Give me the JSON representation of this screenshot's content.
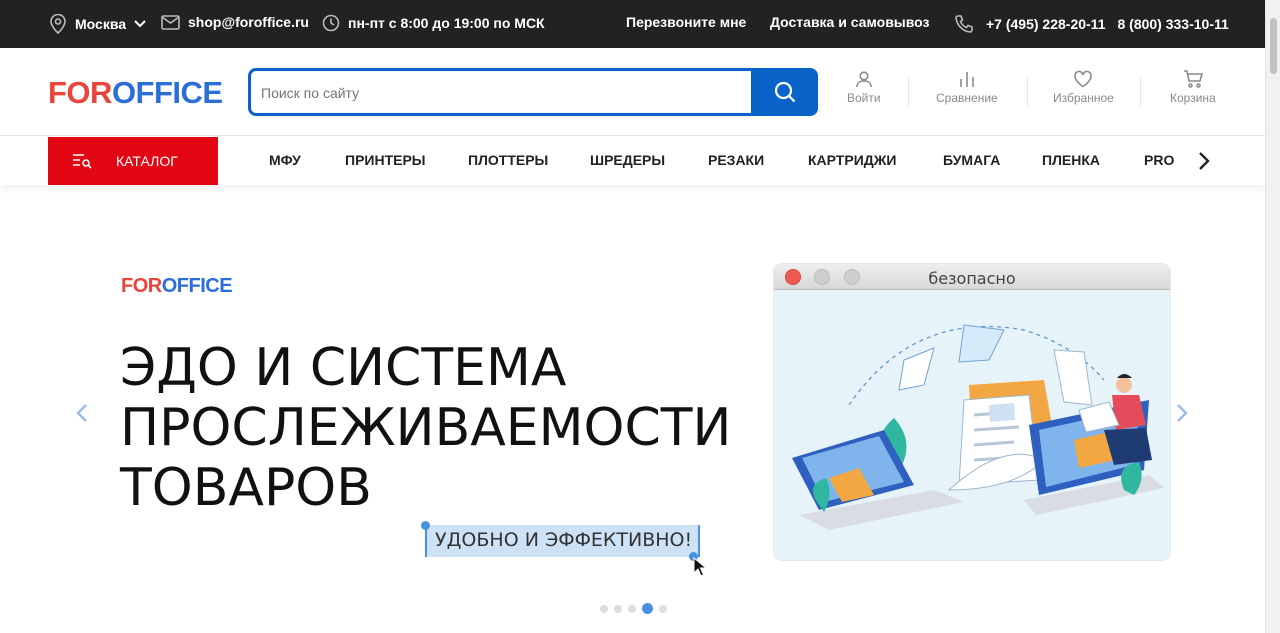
{
  "topbar": {
    "city": "Москва",
    "email": "shop@foroffice.ru",
    "hours": "пн-пт с 8:00 до 19:00 по МСК",
    "callback": "Перезвоните мне",
    "delivery": "Доставка и самовывоз",
    "phone1": "+7 (495) 228-20-11",
    "phone2": "8 (800) 333-10-11"
  },
  "header": {
    "logo_red": "FOR",
    "logo_blue": "OFFICE",
    "search_placeholder": "Поиск по сайту",
    "login": "Войти",
    "compare": "Сравнение",
    "favorites": "Избранное",
    "cart": "Корзина"
  },
  "nav": {
    "catalog": "КАТАЛОГ",
    "items": [
      "МФУ",
      "ПРИНТЕРЫ",
      "ПЛОТТЕРЫ",
      "ШРЕДЕРЫ",
      "РЕЗАКИ",
      "КАРТРИДЖИ",
      "БУМАГА",
      "ПЛЕНКА",
      "PRO"
    ]
  },
  "banner": {
    "logo_red": "FOR",
    "logo_blue": "OFFICE",
    "headline_line1": "ЭДО И СИСТЕМА",
    "headline_line2": "ПРОСЛЕЖИВАЕМОСТИ",
    "headline_line3": "ТОВАРОВ",
    "subtitle": "УДОБНО И ЭФФЕКТИВНО!",
    "window_title": "безопасно",
    "slide_count": 5,
    "active_slide": 4
  },
  "colors": {
    "brand_red": "#e30613",
    "brand_blue": "#0a63c8",
    "topbar_bg": "#222222",
    "highlight": "#cde1f7"
  }
}
